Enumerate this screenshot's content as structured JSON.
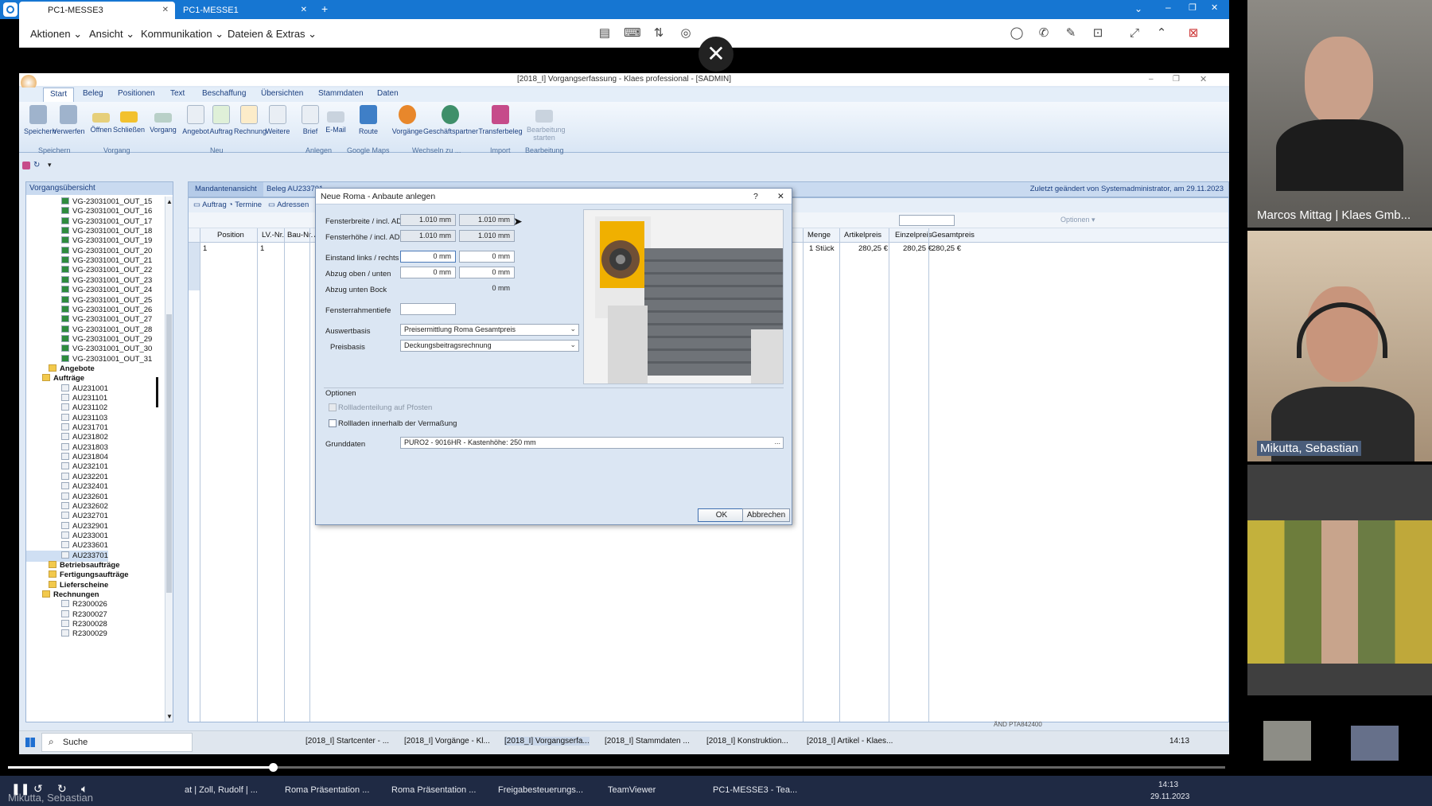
{
  "teamviewer": {
    "tabs": [
      "PC1-MESSE3",
      "PC1-MESSE1"
    ],
    "menus": [
      "Aktionen",
      "Ansicht",
      "Kommunikation",
      "Dateien & Extras"
    ],
    "close_symbol": "✕",
    "new_tab_symbol": "+"
  },
  "app": {
    "title": "[2018_I] Vorgangserfassung - Klaes professional - [SADMIN]",
    "ribbon_tabs": [
      "Start",
      "Beleg",
      "Positionen",
      "Text",
      "Beschaffung",
      "Übersichten",
      "Stammdaten",
      "Daten"
    ],
    "ribbon_buttons": [
      {
        "label": "Speichern",
        "color": "#9fb3cc"
      },
      {
        "label": "Verwerfen",
        "color": "#9fb3cc"
      },
      {
        "label": "Öffnen",
        "color": "#e6cf7a"
      },
      {
        "label": "Schließen",
        "color": "#f2c12e"
      },
      {
        "label": "Vorgang",
        "color": "#b9d0c8"
      },
      {
        "label": "Angebot",
        "color": "#e9eef4"
      },
      {
        "label": "Auftrag",
        "color": "#dff0d8"
      },
      {
        "label": "Rechnung",
        "color": "#fcecc9"
      },
      {
        "label": "Weitere",
        "color": "#e9eef4"
      },
      {
        "label": "Brief",
        "color": "#e9eef4"
      },
      {
        "label": "E-Mail",
        "color": "#c9d3de"
      },
      {
        "label": "Route",
        "color": "#3f7fc7"
      },
      {
        "label": "Vorgänge",
        "color": "#e8872b"
      },
      {
        "label": "Geschäftspartner",
        "color": "#3f8f6a"
      },
      {
        "label": "Transferbeleg",
        "color": "#c64b8a"
      },
      {
        "label": "Bearbeitung starten",
        "color": "#c9d3de"
      }
    ],
    "ribbon_groups": [
      "Speichern",
      "Vorgang",
      "Neu",
      "Anlegen",
      "Google Maps",
      "Wechseln zu ...",
      "Import",
      "Bearbeitung"
    ]
  },
  "left_panel": {
    "title": "Vorgangsübersicht",
    "vg_items": [
      "VG-23031001_OUT_15",
      "VG-23031001_OUT_16",
      "VG-23031001_OUT_17",
      "VG-23031001_OUT_18",
      "VG-23031001_OUT_19",
      "VG-23031001_OUT_20",
      "VG-23031001_OUT_21",
      "VG-23031001_OUT_22",
      "VG-23031001_OUT_23",
      "VG-23031001_OUT_24",
      "VG-23031001_OUT_25",
      "VG-23031001_OUT_26",
      "VG-23031001_OUT_27",
      "VG-23031001_OUT_28",
      "VG-23031001_OUT_29",
      "VG-23031001_OUT_30",
      "VG-23031001_OUT_31"
    ],
    "folder_angebote": "Angebote",
    "folder_auftraege": "Aufträge",
    "au_items": [
      "AU231001",
      "AU231101",
      "AU231102",
      "AU231103",
      "AU231701",
      "AU231802",
      "AU231803",
      "AU231804",
      "AU232101",
      "AU232201",
      "AU232401",
      "AU232601",
      "AU232602",
      "AU232701",
      "AU232901",
      "AU233001",
      "AU233601",
      "AU233701"
    ],
    "folders_after": [
      "Betriebsaufträge",
      "Fertigungsaufträge",
      "Lieferscheine",
      "Rechnungen"
    ],
    "r_items": [
      "R2300026",
      "R2300027",
      "R2300028",
      "R2300029"
    ]
  },
  "main": {
    "tab_mandant": "Mandantenansicht",
    "beleg": "Beleg AU233701",
    "last_changed": "Zuletzt geändert von Systemadministrator, am 29.11.2023",
    "subtabs": [
      "Auftrag",
      "Termine",
      "Adressen"
    ],
    "options_label": "Optionen",
    "columns": [
      "Position",
      "LV.-Nr.",
      "Bau-Nr.",
      "A",
      "Menge",
      "Artikelpreis",
      "Einzelpreis",
      "Gesamtpreis"
    ],
    "row": {
      "pos": "1",
      "lv": "1",
      "menge": "1 Stück",
      "artikelpreis": "280,25 €",
      "einzelpreis": "280,25 €",
      "gesamtpreis": "280,25 €"
    }
  },
  "dialog": {
    "title": "Neue Roma - Anbaute anlegen",
    "help": "?",
    "close": "✕",
    "fields": {
      "fensterbreite_label": "Fensterbreite / incl. AD",
      "fensterbreite_1": "1.010 mm",
      "fensterbreite_2": "1.010 mm",
      "fensterhoehe_label": "Fensterhöhe / incl. AD",
      "fensterhoehe_1": "1.010 mm",
      "fensterhoehe_2": "1.010 mm",
      "einstand_label": "Einstand links / rechts",
      "einstand_1": "0 mm",
      "einstand_2": "0 mm",
      "abzug_label": "Abzug oben / unten",
      "abzug_1": "0 mm",
      "abzug_2": "0 mm",
      "abzug_bock_label": "Abzug unten Bock",
      "abzug_bock": "0 mm",
      "rahmentiefe_label": "Fensterrahmentiefe",
      "rahmentiefe": "",
      "auswertbasis_label": "Auswertbasis",
      "auswertbasis": "Preisermittlung Roma Gesamtpreis",
      "preisbasis_label": "Preisbasis",
      "preisbasis": "Deckungsbeitragsrechnung"
    },
    "optionen_label": "Optionen",
    "opt1": "Rollladenteilung auf Pfosten",
    "opt2": "Rollladen innerhalb der Vermaßung",
    "grunddaten_label": "Grunddaten",
    "grunddaten": "PURO2 - 9016HR - Kastenhöhe: 250 mm",
    "ellipsis": "...",
    "ok": "OK",
    "cancel": "Abbrechen"
  },
  "remote_taskbar": {
    "search": "Suche",
    "items": [
      "[2018_I] Startcenter - ...",
      "[2018_I] Vorgänge - Kl...",
      "[2018_I] Vorgangserfa...",
      "[2018_I] Stammdaten ...",
      "[2018_I] Konstruktion...",
      "[2018_I] Artikel - Klaes..."
    ],
    "status": "ÄND",
    "status2": "PTA842400",
    "time": "14:13"
  },
  "local_taskbar": {
    "items": [
      "at | Zoll, Rudolf | ...",
      "Roma Präsentation ...",
      "Roma Präsentation ...",
      "Freigabesteuerungs...",
      "TeamViewer",
      "PC1-MESSE3 - Tea..."
    ],
    "time": "14:13",
    "date": "29.11.2023",
    "caption": "Mikutta, Sebastian"
  },
  "video_panel": {
    "participant1": "Marcos Mittag | Klaes Gmb...",
    "participant2": "Mikutta, Sebastian"
  },
  "colors": {
    "teamviewer_blue": "#1676d2",
    "ribbon_blue": "#1b3f80",
    "dialog_bg": "#dbe6f3"
  }
}
